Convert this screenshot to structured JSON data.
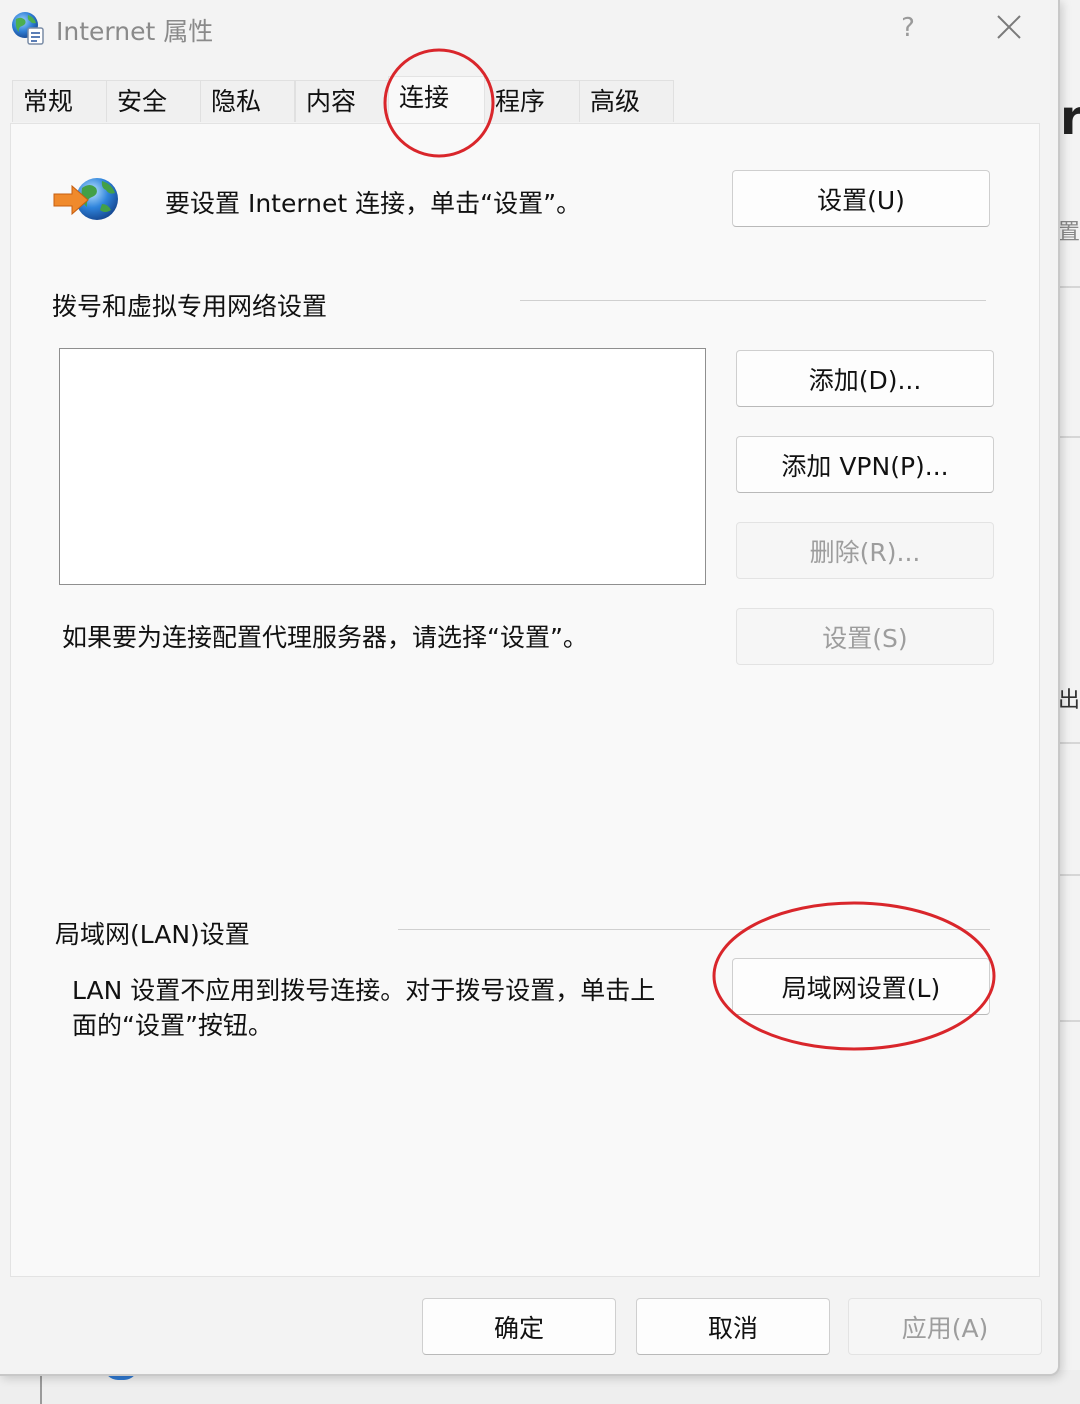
{
  "window": {
    "title": "Internet 属性",
    "help_label": "?",
    "icons": {
      "title": "internet-options-globe-icon",
      "close": "close-icon"
    }
  },
  "tabs": [
    {
      "label": "常规"
    },
    {
      "label": "安全"
    },
    {
      "label": "隐私"
    },
    {
      "label": "内容"
    },
    {
      "label": "连接",
      "active": true
    },
    {
      "label": "程序"
    },
    {
      "label": "高级"
    }
  ],
  "connection": {
    "setup_text": "要设置 Internet 连接，单击“设置”。",
    "setup_button": "设置(U)",
    "setup_icon": "globe-arrow-icon",
    "dialup_section_title": "拨号和虚拟专用网络设置",
    "add_button": "添加(D)...",
    "add_vpn_button": "添加 VPN(P)...",
    "remove_button": "删除(R)...",
    "settings_button": "设置(S)",
    "proxy_text": "如果要为连接配置代理服务器，请选择“设置”。",
    "lan_section_title": "局域网(LAN)设置",
    "lan_text_line1": "LAN 设置不应用到拨号连接。对于拨号设置，单击上",
    "lan_text_line2": "面的“设置”按钮。",
    "lan_button": "局域网设置(L)"
  },
  "footer": {
    "ok_button": "确定",
    "cancel_button": "取消",
    "apply_button": "应用(A)"
  },
  "background": {
    "glyph_top": "r",
    "glyph_mid": "置",
    "glyph_low": "出"
  },
  "colors": {
    "annotation": "#d9262b",
    "disabled_text": "#9d9d9d",
    "panel_bg": "#f9f9f9"
  }
}
